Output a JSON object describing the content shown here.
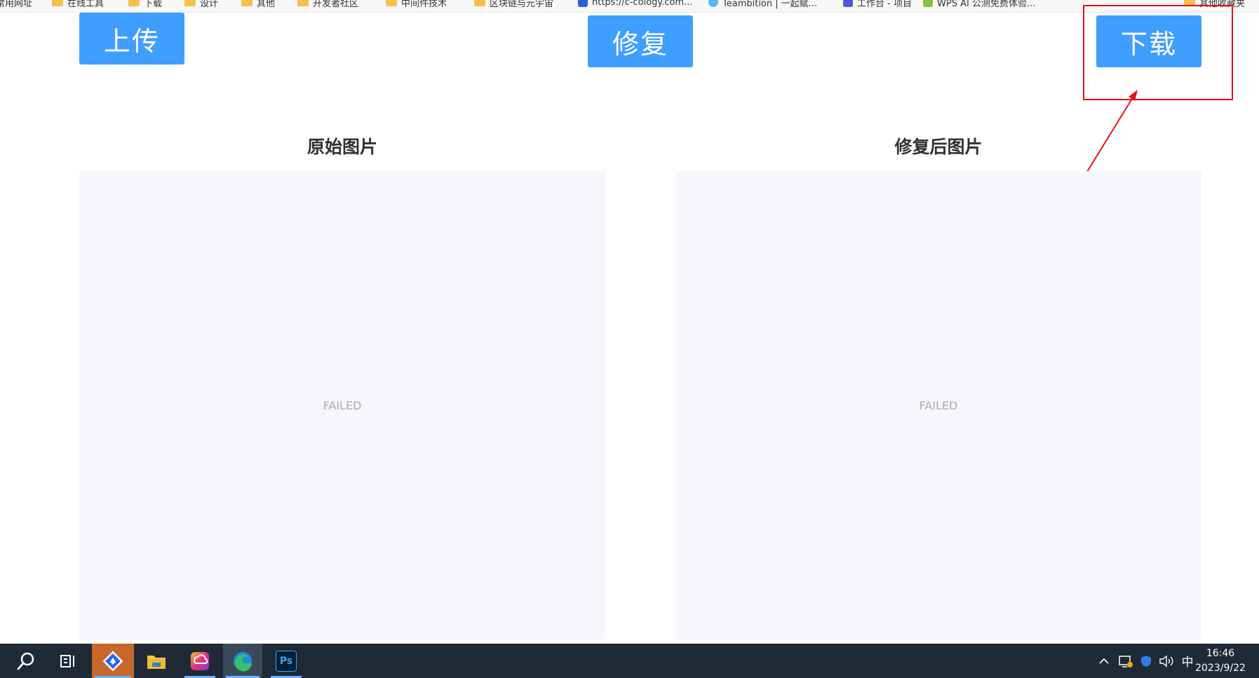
{
  "bookmarks": [
    {
      "label": "常用网址",
      "icon": "folder-icon"
    },
    {
      "label": "在线工具",
      "icon": "folder-icon"
    },
    {
      "label": "下载",
      "icon": "folder-icon"
    },
    {
      "label": "设计",
      "icon": "folder-icon"
    },
    {
      "label": "其他",
      "icon": "folder-icon"
    },
    {
      "label": "开发者社区",
      "icon": "folder-icon"
    },
    {
      "label": "中间件技术",
      "icon": "folder-icon"
    },
    {
      "label": "区块链与元宇宙",
      "icon": "folder-icon"
    },
    {
      "label": "https://c-cology.com...",
      "icon": "site-icon"
    },
    {
      "label": "Teambition | 一起赋...",
      "icon": "site-icon"
    },
    {
      "label": "工作台 - 项目",
      "icon": "site-icon"
    },
    {
      "label": "WPS AI 公测免费体验...",
      "icon": "site-icon"
    },
    {
      "label": "其他收藏夹",
      "icon": "folder-icon"
    }
  ],
  "toolbar": {
    "upload_label": "上传",
    "repair_label": "修复",
    "download_label": "下载"
  },
  "panels": {
    "original_title": "原始图片",
    "original_status": "FAILED",
    "repaired_title": "修复后图片",
    "repaired_status": "FAILED"
  },
  "taskbar": {
    "apps": [
      "search-icon",
      "task-view-icon",
      "feishu-icon",
      "file-explorer-icon",
      "creative-cloud-icon",
      "edge-icon",
      "photoshop-icon"
    ],
    "photoshop_label": "Ps",
    "tray": {
      "chevron": "^",
      "ime": "中",
      "time": "16:46",
      "date": "2023/9/22"
    }
  },
  "colors": {
    "primary_button": "#409eff",
    "annotation_red": "#e8101a",
    "panel_bg": "#f5f7fa",
    "taskbar_bg": "#1f2a36"
  }
}
